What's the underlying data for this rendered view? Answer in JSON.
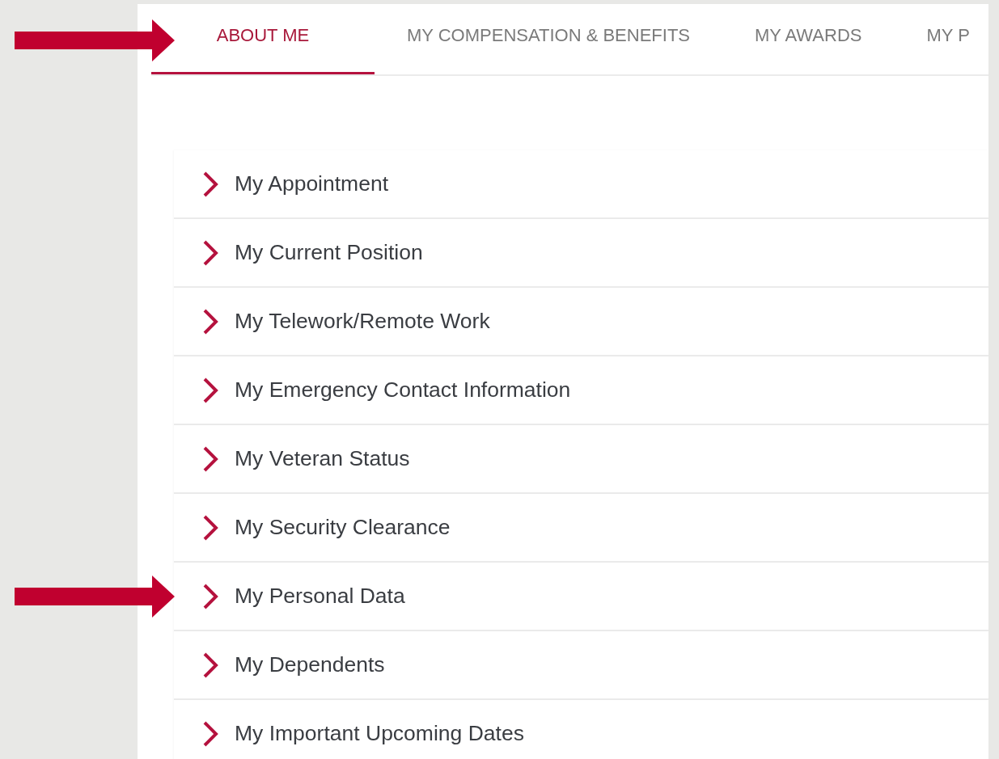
{
  "tab_arrow": true,
  "tabs": [
    {
      "label": "ABOUT ME",
      "selected": true
    },
    {
      "label": "MY COMPENSATION & BENEFITS",
      "selected": false
    },
    {
      "label": "MY AWARDS",
      "selected": false
    },
    {
      "label": "MY P",
      "selected": false
    }
  ],
  "sections": [
    {
      "label": "My Appointment",
      "expanded": false,
      "marked": false
    },
    {
      "label": "My Current Position",
      "expanded": false,
      "marked": false
    },
    {
      "label": "My Telework/Remote Work",
      "expanded": false,
      "marked": false
    },
    {
      "label": "My Emergency Contact Information",
      "expanded": false,
      "marked": false
    },
    {
      "label": "My Veteran Status",
      "expanded": false,
      "marked": false
    },
    {
      "label": "My Security Clearance",
      "expanded": false,
      "marked": false
    },
    {
      "label": "My Personal Data",
      "expanded": false,
      "marked": true
    },
    {
      "label": "My Dependents",
      "expanded": false,
      "marked": false
    },
    {
      "label": "My Important Upcoming Dates",
      "expanded": false,
      "marked": false
    }
  ]
}
